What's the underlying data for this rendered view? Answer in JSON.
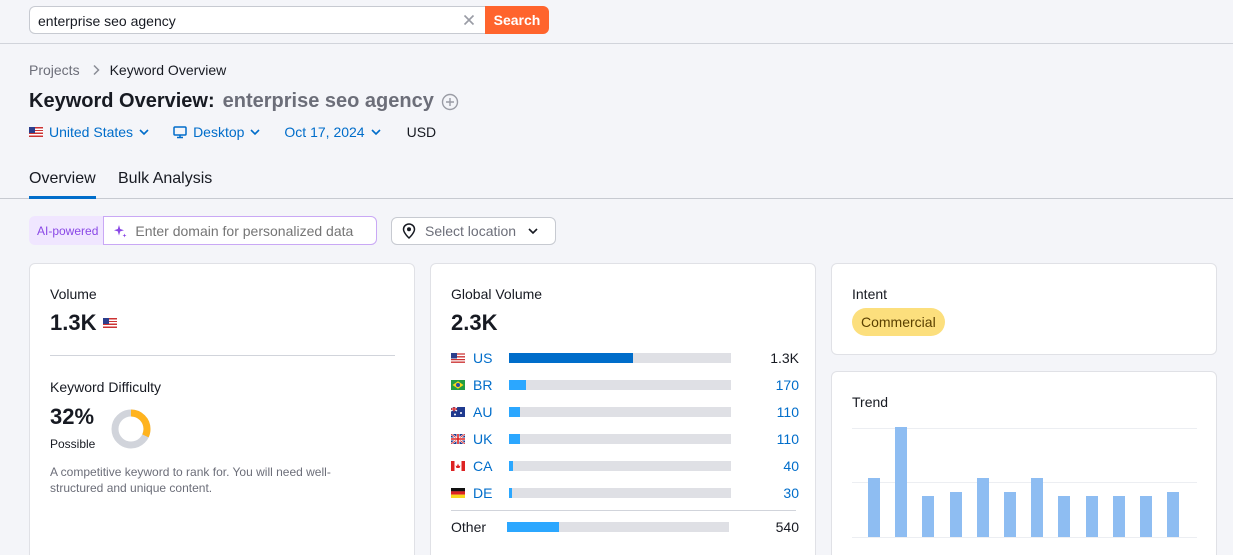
{
  "search": {
    "value": "enterprise seo agency",
    "button": "Search"
  },
  "breadcrumb": {
    "parent": "Projects",
    "current": "Keyword Overview"
  },
  "title": {
    "prefix": "Keyword Overview:",
    "keyword": "enterprise seo agency"
  },
  "filters": {
    "country": "United States",
    "device": "Desktop",
    "date": "Oct 17, 2024",
    "currency": "USD"
  },
  "tabs": [
    "Overview",
    "Bulk Analysis"
  ],
  "ai": {
    "badge": "AI-powered",
    "placeholder": "Enter domain for personalized data"
  },
  "location": {
    "placeholder": "Select location"
  },
  "volume": {
    "label": "Volume",
    "value": "1.3K"
  },
  "keyword_difficulty": {
    "label": "Keyword Difficulty",
    "value": "32%",
    "level": "Possible",
    "percent": 32,
    "description": "A competitive keyword to rank for. You will need well-structured and unique content."
  },
  "global_volume": {
    "label": "Global Volume",
    "value": "2.3K",
    "rows": [
      {
        "country": "US",
        "value": "1.3K",
        "share": 0.56,
        "color": "#006dca"
      },
      {
        "country": "BR",
        "value": "170",
        "share": 0.075,
        "color": "#2ba7ff"
      },
      {
        "country": "AU",
        "value": "110",
        "share": 0.048,
        "color": "#2ba7ff"
      },
      {
        "country": "UK",
        "value": "110",
        "share": 0.048,
        "color": "#2ba7ff"
      },
      {
        "country": "CA",
        "value": "40",
        "share": 0.018,
        "color": "#2ba7ff"
      },
      {
        "country": "DE",
        "value": "30",
        "share": 0.013,
        "color": "#2ba7ff"
      }
    ],
    "other": {
      "label": "Other",
      "value": "540",
      "share": 0.235,
      "color": "#2ba7ff"
    }
  },
  "intent": {
    "label": "Intent",
    "value": "Commercial"
  },
  "trend": {
    "label": "Trend",
    "values": [
      0.54,
      1.0,
      0.37,
      0.41,
      0.54,
      0.41,
      0.54,
      0.37,
      0.37,
      0.37,
      0.37,
      0.41
    ]
  }
}
